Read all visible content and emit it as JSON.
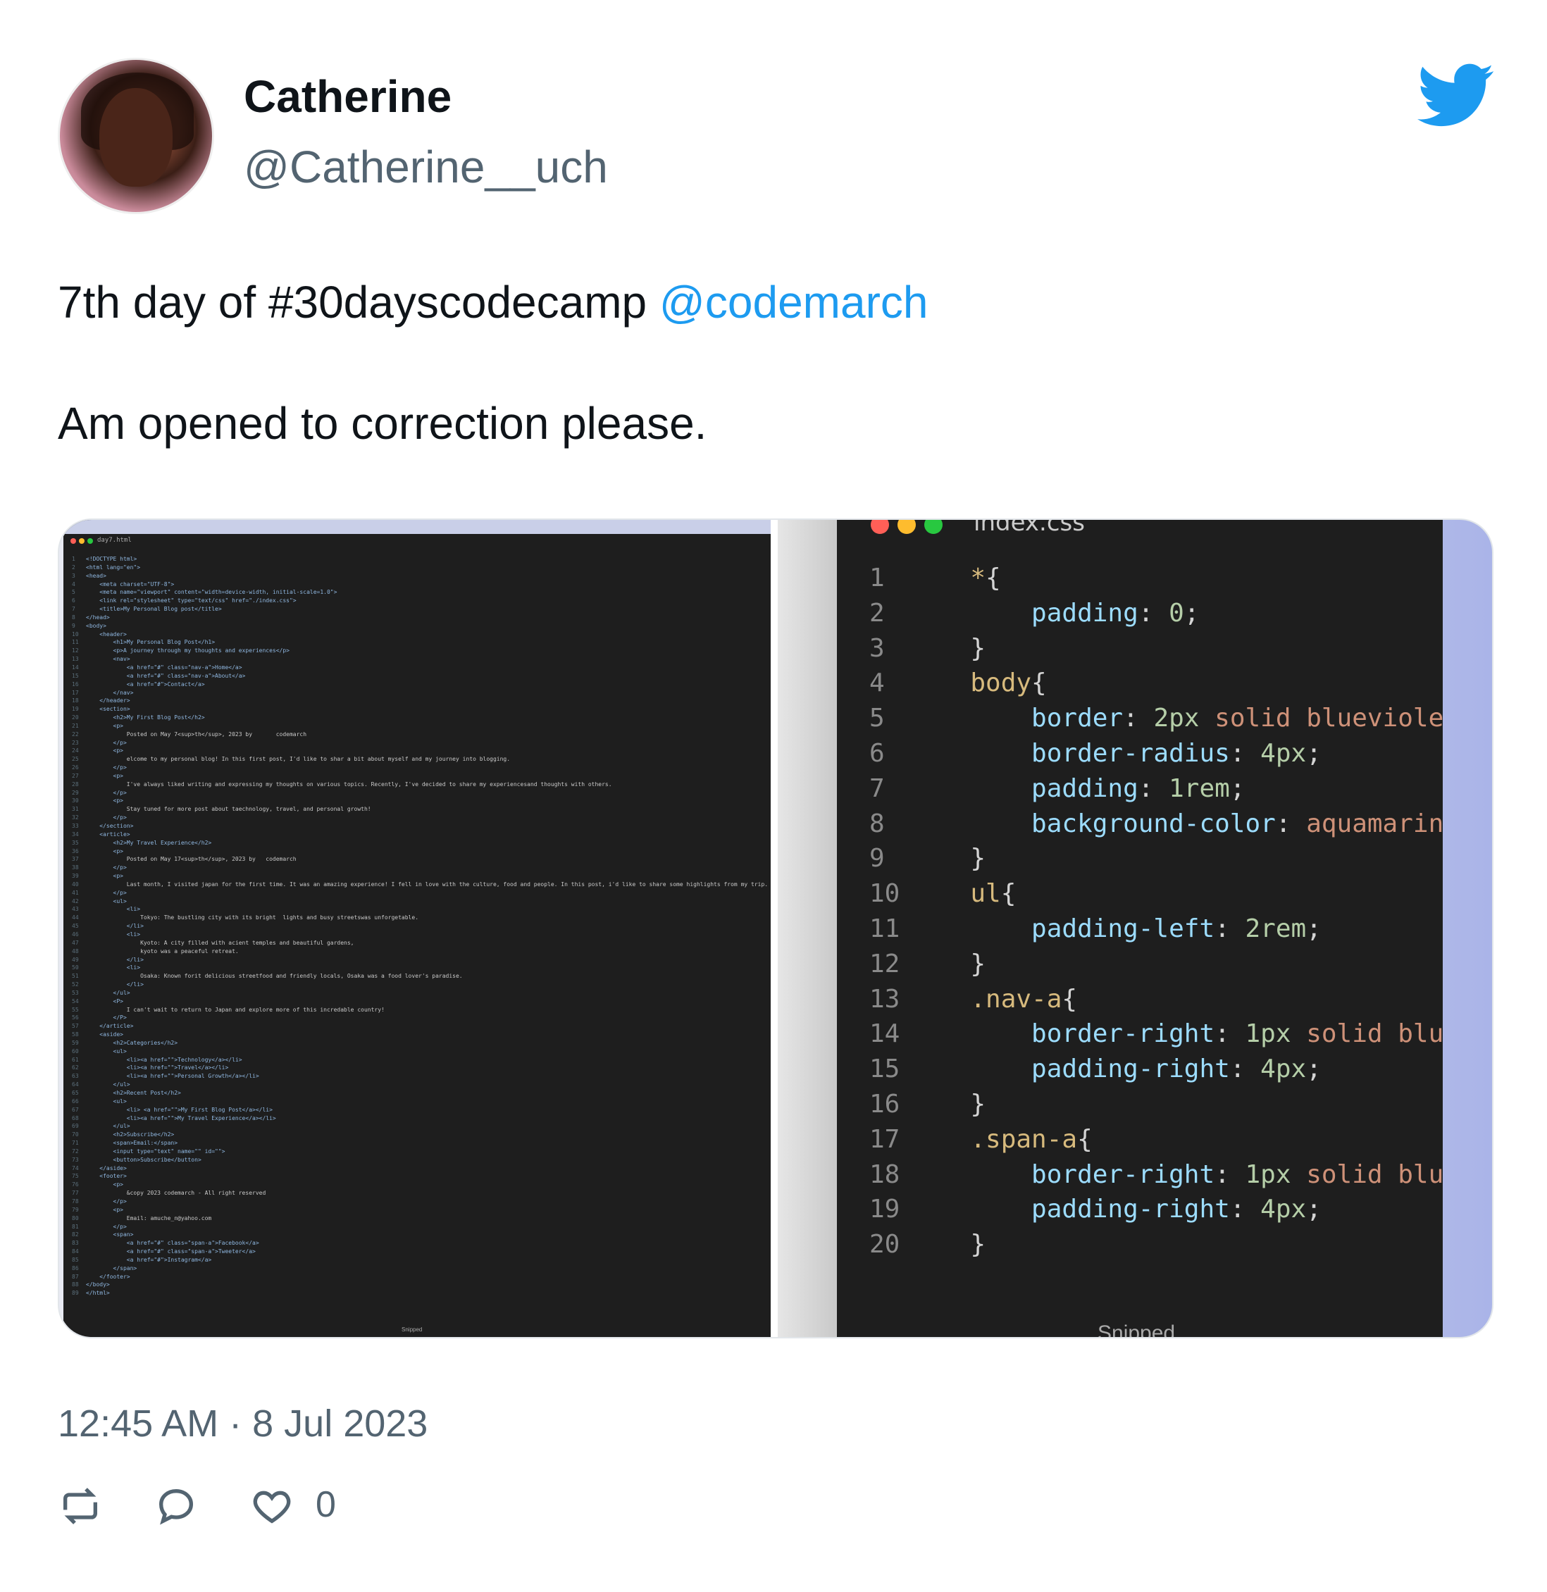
{
  "tweet": {
    "author_name": "Catherine",
    "author_handle": "@Catherine__uch",
    "text_line1": "7th day of #30dayscodecamp ",
    "mention": "@codemarch",
    "text_line2": "Am opened to correction please.",
    "timestamp": "12:45 AM · 8 Jul 2023",
    "like_count": "0"
  },
  "icons": {
    "brand": "twitter-bird-icon",
    "retweet": "retweet-icon",
    "reply": "reply-icon",
    "like": "heart-icon"
  },
  "colors": {
    "brand": "#1d9bf0",
    "text": "#0f1419",
    "muted": "#536471"
  },
  "left_editor": {
    "filename": "day7.html",
    "footer": "Snipped",
    "lines": [
      "<!DOCTYPE html>",
      "<html lang=\"en\">",
      "<head>",
      "    <meta charset=\"UTF-8\">",
      "    <meta name=\"viewport\" content=\"width=device-width, initial-scale=1.0\">",
      "    <link rel=\"stylesheet\" type=\"text/css\" href=\"./index.css\">",
      "    <title>My Personal Blog post</title>",
      "</head>",
      "<body>",
      "    <header>",
      "        <h1>My Personal Blog Post</h1>",
      "        <p>A journey through my thoughts and experiences</p>",
      "        <nav>",
      "            <a href=\"#\" class=\"nav-a\">Home</a>",
      "            <a href=\"#\" class=\"nav-a\">About</a>",
      "            <a href=\"#\">Contact</a>",
      "        </nav>",
      "    </header>",
      "    <section>",
      "        <h2>My First Blog Post</h2>",
      "        <p>",
      "            Posted on May 7<sup>th</sup>, 2023 by       codemarch",
      "        </p>",
      "        <p>",
      "            elcome to my personal blog! In this first post, I'd like to shar a bit about myself and my journey into blogging.",
      "        </p>",
      "        <p>",
      "            I've always liked writing and expressing my thoughts on various topics. Recently, I've decided to share my experiencesand thoughts with others.",
      "        </p>",
      "        <p>",
      "            Stay tuned for more post about taechnology, travel, and personal growth!",
      "        </p>",
      "    </section>",
      "    <article>",
      "        <h2>My Travel Experience</h2>",
      "        <p>",
      "            Posted on May 17<sup>th</sup>, 2023 by   codemarch",
      "        </p>",
      "        <p>",
      "            Last month, I visited japan for the first time. It was an amazing experience! I fell in love with the culture, food and people. In this post, i'd like to share some highlights from my trip.",
      "        </p>",
      "        <ul>",
      "            <li>",
      "                Tokyo: The bustling city with its bright  lights and busy streetswas unforgetable.",
      "            </li>",
      "            <li>",
      "                Kyoto: A city filled with acient temples and beautiful gardens,",
      "                kyoto was a peaceful retreat.",
      "            </li>",
      "            <li>",
      "                Osaka: Known forit delicious streetfood and friendly locals, Osaka was a food lover's paradise.",
      "            </li>",
      "        </ul>",
      "        <P>",
      "            I can't wait to return to Japan and explore more of this incredable country!",
      "        </P>",
      "    </article>",
      "    <aside>",
      "        <h2>Categories</h2>",
      "        <ul>",
      "            <li><a href=\"\">Technology</a></li>",
      "            <li><a href=\"\">Travel</a></li>",
      "            <li><a href=\"\">Personal Growth</a></li>",
      "        </ul>",
      "        <h2>Recent Post</h2>",
      "        <ul>",
      "            <li> <a href=\"\">My First Blog Post</a></li>",
      "            <li><a href=\"\">My Travel Experience</a></li>",
      "        </ul>",
      "        <h2>Subscribe</h2>",
      "        <span>Email:</span>",
      "        <input type=\"text\" name=\"\" id=\"\">",
      "        <button>Subscribe</button>",
      "    </aside>",
      "    <footer>",
      "        <p>",
      "            &copy 2023 codemarch - All right reserved",
      "        </p>",
      "        <p>",
      "            Email: amuche_n@yahoo.com",
      "        </p>",
      "        <span>",
      "            <a href=\"#\" class=\"span-a\">Facebook</a>",
      "            <a href=\"#\" class=\"span-a\">Tweeter</a>",
      "            <a href=\"#\">Instagram</a>",
      "        </span>",
      "    </footer>",
      "</body>",
      "</html>"
    ]
  },
  "right_editor": {
    "filename": "index.css",
    "footer": "Snipped",
    "lines": [
      {
        "n": "1",
        "sel": "*",
        "open": "{"
      },
      {
        "n": "2",
        "prop": "padding",
        "val": "0"
      },
      {
        "n": "3",
        "close": "}"
      },
      {
        "n": "4",
        "sel": "body",
        "open": "{"
      },
      {
        "n": "5",
        "prop": "border",
        "val": "2px",
        "kw": "solid blueviolet"
      },
      {
        "n": "6",
        "prop": "border-radius",
        "val": "4px"
      },
      {
        "n": "7",
        "prop": "padding",
        "val": "1rem"
      },
      {
        "n": "8",
        "prop": "background-color",
        "kw": "aquamarine"
      },
      {
        "n": "9",
        "close": "}"
      },
      {
        "n": "10",
        "sel": "ul",
        "open": "{"
      },
      {
        "n": "11",
        "prop": "padding-left",
        "val": "2rem"
      },
      {
        "n": "12",
        "close": "}"
      },
      {
        "n": "13",
        "sel": ".nav-a",
        "open": "{"
      },
      {
        "n": "14",
        "prop": "border-right",
        "val": "1px",
        "kw": "solid blue"
      },
      {
        "n": "15",
        "prop": "padding-right",
        "val": "4px"
      },
      {
        "n": "16",
        "close": "}"
      },
      {
        "n": "17",
        "sel": ".span-a",
        "open": "{"
      },
      {
        "n": "18",
        "prop": "border-right",
        "val": "1px",
        "kw": "solid blue"
      },
      {
        "n": "19",
        "prop": "padding-right",
        "val": "4px"
      },
      {
        "n": "20",
        "close": "}"
      }
    ]
  }
}
